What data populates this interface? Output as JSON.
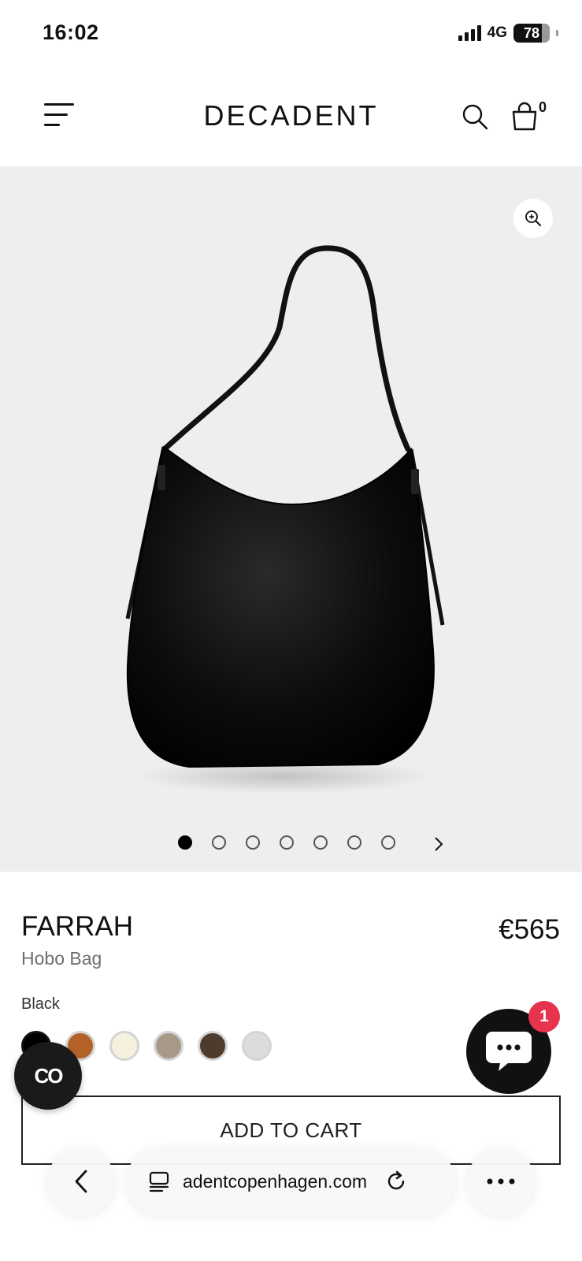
{
  "status_bar": {
    "time": "16:02",
    "network": "4G",
    "battery": "78"
  },
  "header": {
    "brand": "DECADENT",
    "cart_count": "0",
    "icons": [
      "menu-icon",
      "search-icon",
      "bag-icon"
    ]
  },
  "gallery": {
    "image_count": 7,
    "active_index": 0,
    "icons": [
      "zoom-in-icon",
      "chevron-right-icon"
    ]
  },
  "product": {
    "name": "FARRAH",
    "type": "Hobo Bag",
    "price": "€565",
    "selected_color": "Black",
    "swatches": [
      "#000000",
      "#b3622a",
      "#f6f0de",
      "#a89888",
      "#4f3b2b",
      "#dcdcdc"
    ]
  },
  "cta": {
    "add_to_cart": "ADD TO CART",
    "below_text": "I                                          s"
  },
  "floating": {
    "co_label": "CO",
    "chat_badge": "1"
  },
  "browser": {
    "url": "adentcopenhagen.com",
    "icons": [
      "back-icon",
      "tabs-icon",
      "reload-icon",
      "more-icon"
    ]
  },
  "colors": {
    "gallery_bg": "#eeeeee",
    "badge_red": "#e8334f",
    "text_muted": "#6e6e6e"
  }
}
